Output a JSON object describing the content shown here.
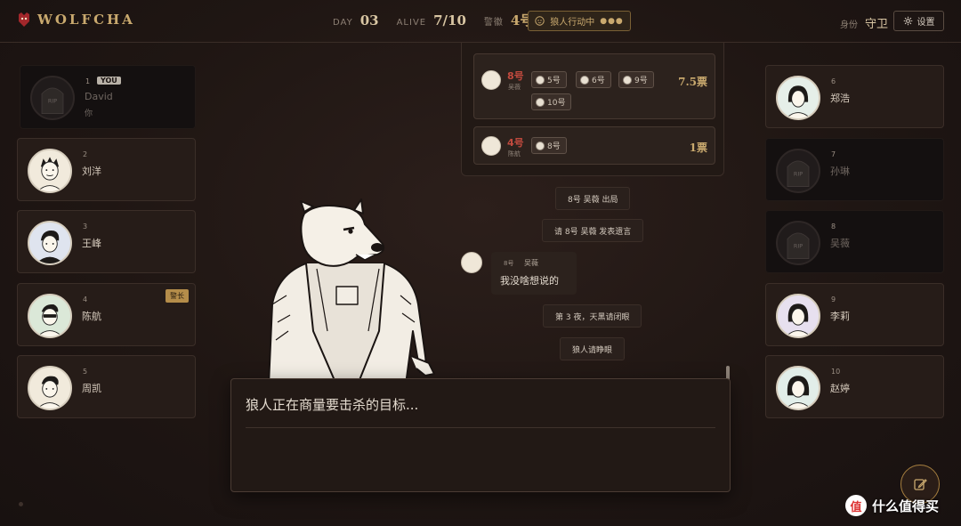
{
  "brand": {
    "name": "WOLFCHA"
  },
  "stats": {
    "day_label": "DAY",
    "day_value": "03",
    "alive_label": "ALIVE",
    "alive_value": "7/10",
    "sheriff_label": "警徽",
    "sheriff_value": "4号"
  },
  "phase": {
    "label": "狼人行动中",
    "dots": "●●●"
  },
  "role": {
    "label": "身份",
    "value": "守卫"
  },
  "settings": {
    "label": "设置"
  },
  "left_seats": [
    {
      "num": "1",
      "name": "David",
      "sub": "你",
      "badge": "YOU",
      "dead": true,
      "rip": "RIP"
    },
    {
      "num": "2",
      "name": "刘洋"
    },
    {
      "num": "3",
      "name": "王峰"
    },
    {
      "num": "4",
      "name": "陈航",
      "badge": "警长"
    },
    {
      "num": "5",
      "name": "周凯"
    }
  ],
  "right_seats": [
    {
      "num": "6",
      "name": "郑浩"
    },
    {
      "num": "7",
      "name": "孙琳",
      "dead": true,
      "rip": "RIP"
    },
    {
      "num": "8",
      "name": "吴薇",
      "dead": true,
      "rip": "RIP"
    },
    {
      "num": "9",
      "name": "李莉"
    },
    {
      "num": "10",
      "name": "赵婷"
    }
  ],
  "votes": [
    {
      "target": "8号",
      "target_name": "吴薇",
      "voters": [
        "5号",
        "6号",
        "9号",
        "10号"
      ],
      "count": "7.5票"
    },
    {
      "target": "4号",
      "target_name": "陈航",
      "voters": [
        "8号"
      ],
      "count": "1票"
    }
  ],
  "messages": {
    "out": "8号 吴薇 出局",
    "last_words": "请 8号 吴薇 发表遗言",
    "night": "第 3 夜，天黑请闭眼",
    "wolves_open": "狼人请睁眼"
  },
  "chat": {
    "num": "8号",
    "name": "吴薇",
    "text": "我没啥想说的"
  },
  "dialog": {
    "text": "狼人正在商量要击杀的目标..."
  },
  "watermark": {
    "logo": "值",
    "text": "什么值得买"
  }
}
